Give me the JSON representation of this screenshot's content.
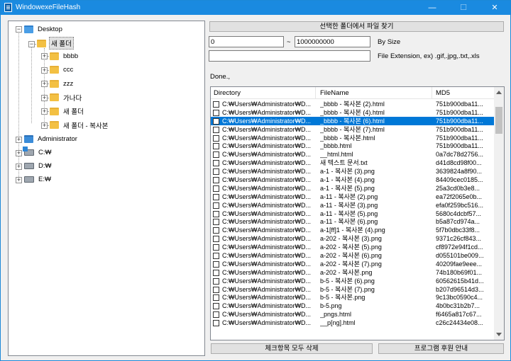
{
  "window": {
    "title": "WindowexeFileHash",
    "minimize": "—",
    "maximize": "☐",
    "close": "✕"
  },
  "tree": {
    "desktop": "Desktop",
    "new_folder": "새 폴더",
    "children": [
      "bbbb",
      "ccc",
      "zzz",
      "가나다",
      "새 폴더",
      "새 폴더 - 복사본"
    ],
    "administrator": "Administrator",
    "c": "C:₩",
    "d": "D:₩",
    "e": "E:₩"
  },
  "controls": {
    "select_button": "선택한 폴더에서 파일 찾기",
    "size_min": "0",
    "size_tilde": "~",
    "size_max": "1000000000",
    "size_label": "By Size",
    "ext_value": "",
    "ext_label": "File Extension, ex) .gif,.jpg,.txt,.xls",
    "status": "Done.,",
    "delete_button": "체크항목 모두 삭제",
    "donate_button": "프로그램 후원 안내"
  },
  "list": {
    "columns": [
      "Directory",
      "FileName",
      "MD5"
    ],
    "rows": [
      [
        "C:₩Users₩Administrator₩D...",
        "_bbbb - 복사본 (2).html",
        "751b900dba11..."
      ],
      [
        "C:₩Users₩Administrator₩D...",
        "_bbbb - 복사본 (4).html",
        "751b900dba11..."
      ],
      [
        "C:₩Users₩Administrator₩D...",
        "_bbbb - 복사본 (6).html",
        "751b900dba11..."
      ],
      [
        "C:₩Users₩Administrator₩D...",
        "_bbbb - 복사본 (7).html",
        "751b900dba11..."
      ],
      [
        "C:₩Users₩Administrator₩D...",
        "_bbbb - 복사본.html",
        "751b900dba11..."
      ],
      [
        "C:₩Users₩Administrator₩D...",
        "_bbbb.html",
        "751b900dba11..."
      ],
      [
        "C:₩Users₩Administrator₩D...",
        "__html.html",
        "0a7dc78d2756..."
      ],
      [
        "C:₩Users₩Administrator₩D...",
        "새 텍스트 문서.txt",
        "d41d8cd98f00..."
      ],
      [
        "C:₩Users₩Administrator₩D...",
        "a-1 - 복사본 (3).png",
        "3639824a8f90..."
      ],
      [
        "C:₩Users₩Administrator₩D...",
        "a-1 - 복사본 (4).png",
        "84409cec0185..."
      ],
      [
        "C:₩Users₩Administrator₩D...",
        "a-1 - 복사본 (5).png",
        "25a3cd0b3e8..."
      ],
      [
        "C:₩Users₩Administrator₩D...",
        "a-11 - 복사본 (2).png",
        "ea72f2065e0b..."
      ],
      [
        "C:₩Users₩Administrator₩D...",
        "a-11 - 복사본 (3).png",
        "efa0f259bc516..."
      ],
      [
        "C:₩Users₩Administrator₩D...",
        "a-11 - 복사본 (5).png",
        "5680c4dcbf57..."
      ],
      [
        "C:₩Users₩Administrator₩D...",
        "a-11 - 복사본 (6).png",
        "b5a87cd974a..."
      ],
      [
        "C:₩Users₩Administrator₩D...",
        "a-1[ff]1 - 복사본 (4).png",
        "5f7b0dbc33f8..."
      ],
      [
        "C:₩Users₩Administrator₩D...",
        "a-202 - 복사본 (3).png",
        "9371c26cf843..."
      ],
      [
        "C:₩Users₩Administrator₩D...",
        "a-202 - 복사본 (5).png",
        "cf8972e94f1cd..."
      ],
      [
        "C:₩Users₩Administrator₩D...",
        "a-202 - 복사본 (6).png",
        "d055101be009..."
      ],
      [
        "C:₩Users₩Administrator₩D...",
        "a-202 - 복사본 (7).png",
        "40209fae9eee..."
      ],
      [
        "C:₩Users₩Administrator₩D...",
        "a-202 - 복사본.png",
        "74b180b69f01..."
      ],
      [
        "C:₩Users₩Administrator₩D...",
        "b-5 - 복사본 (6).png",
        "60562615b41d..."
      ],
      [
        "C:₩Users₩Administrator₩D...",
        "b-5 - 복사본 (7).png",
        "b207d96514d3..."
      ],
      [
        "C:₩Users₩Administrator₩D...",
        "b-5 - 복사본.png",
        "9c13bc0590c4..."
      ],
      [
        "C:₩Users₩Administrator₩D...",
        "b-5.png",
        "4b0bc31b2b7..."
      ],
      [
        "C:₩Users₩Administrator₩D...",
        "_pngs.html",
        "f6465a817c67..."
      ],
      [
        "C:₩Users₩Administrator₩D...",
        "__p[ng].html",
        "c26c24434e08..."
      ]
    ],
    "selected_row": 2
  }
}
